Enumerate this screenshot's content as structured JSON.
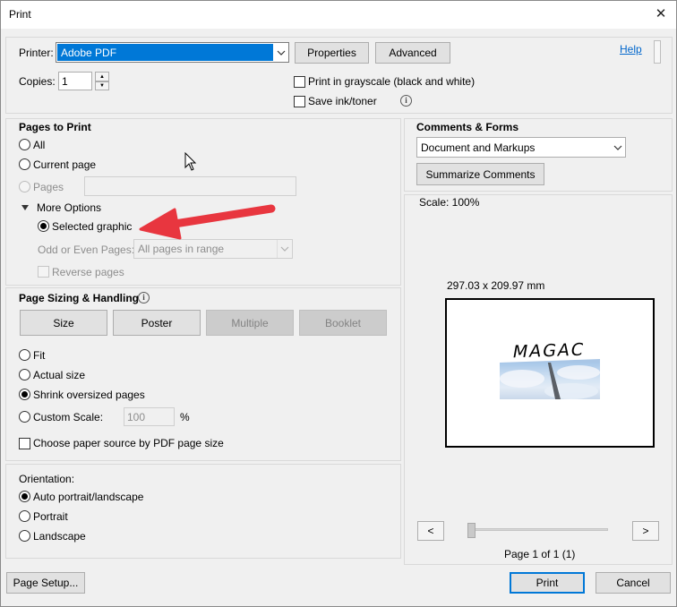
{
  "window": {
    "title": "Print",
    "close_glyph": "✕"
  },
  "printer": {
    "label": "Printer:",
    "selected": "Adobe PDF",
    "properties_label": "Properties",
    "advanced_label": "Advanced",
    "help_label": "Help",
    "copies_label": "Copies:",
    "copies_value": "1",
    "grayscale_label": "Print in grayscale (black and white)",
    "grayscale_checked": false,
    "save_ink_label": "Save ink/toner",
    "save_ink_checked": false
  },
  "pages_to_print": {
    "heading": "Pages to Print",
    "all_label": "All",
    "current_label": "Current page",
    "pages_label": "Pages",
    "pages_value": "",
    "more_options_label": "More Options",
    "selected_graphic_label": "Selected graphic",
    "selected": "Selected graphic",
    "odd_even_label": "Odd or Even Pages:",
    "odd_even_value": "All pages in range",
    "reverse_label": "Reverse pages"
  },
  "page_sizing": {
    "heading": "Page Sizing & Handling",
    "tabs": [
      "Size",
      "Poster",
      "Multiple",
      "Booklet"
    ],
    "active_tab": "Size",
    "fit_label": "Fit",
    "actual_label": "Actual size",
    "shrink_label": "Shrink oversized pages",
    "custom_label": "Custom Scale:",
    "custom_value": "100",
    "percent": "%",
    "selected": "Shrink oversized pages",
    "paper_source_label": "Choose paper source by PDF page size",
    "paper_source_checked": false
  },
  "orientation": {
    "heading": "Orientation:",
    "auto_label": "Auto portrait/landscape",
    "portrait_label": "Portrait",
    "landscape_label": "Landscape",
    "selected": "Auto portrait/landscape"
  },
  "comments_forms": {
    "heading": "Comments & Forms",
    "selected": "Document and Markups",
    "summarize_label": "Summarize Comments"
  },
  "preview": {
    "scale_text": "Scale: 100%",
    "page_size_text": "297.03 x 209.97 mm",
    "thumbnail_text": "MAGAC",
    "prev_label": "<",
    "next_label": ">",
    "page_text": "Page 1 of 1 (1)"
  },
  "footer": {
    "page_setup_label": "Page Setup...",
    "print_label": "Print",
    "cancel_label": "Cancel"
  },
  "colors": {
    "accent_selected": "#0078d7",
    "annotation_arrow": "#e8363f",
    "link": "#0066cc"
  }
}
